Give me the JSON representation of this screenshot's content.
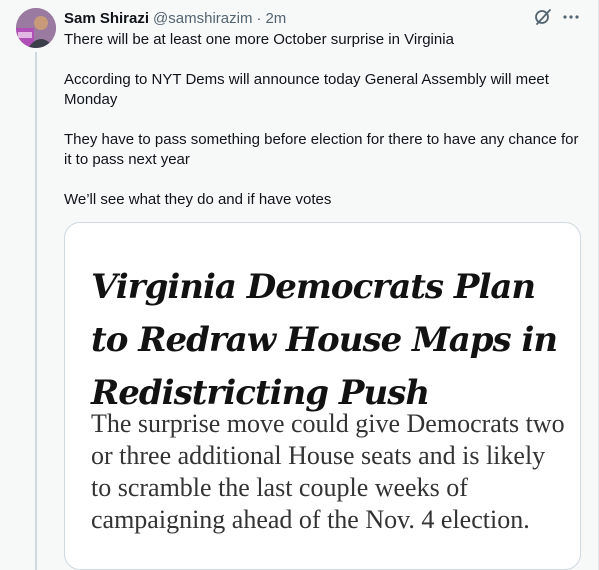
{
  "author": {
    "name": "Sam Shirazi",
    "handle": "@samshirazim",
    "separator": "·",
    "time": "2m"
  },
  "icons": {
    "grok": "grok-icon",
    "more": "more-icon"
  },
  "tweet": {
    "paragraphs": [
      "There will be at least one more October surprise in Virginia",
      "According to NYT Dems will announce today General Assembly will meet Monday",
      "They have to pass something before election for there to have any chance for it to pass next year",
      "We’ll see what they do and if have votes"
    ]
  },
  "card": {
    "headline": "Virginia Democrats Plan to Redraw House Maps in Redistricting Push",
    "subhead": "The surprise move could give Democrats two or three additional House seats and is likely to scramble the last couple weeks of campaigning ahead of the Nov. 4 election."
  },
  "colors": {
    "background": "#f7f9f9",
    "text": "#0f1419",
    "secondary_text": "#536471",
    "border": "#cfd9de"
  }
}
